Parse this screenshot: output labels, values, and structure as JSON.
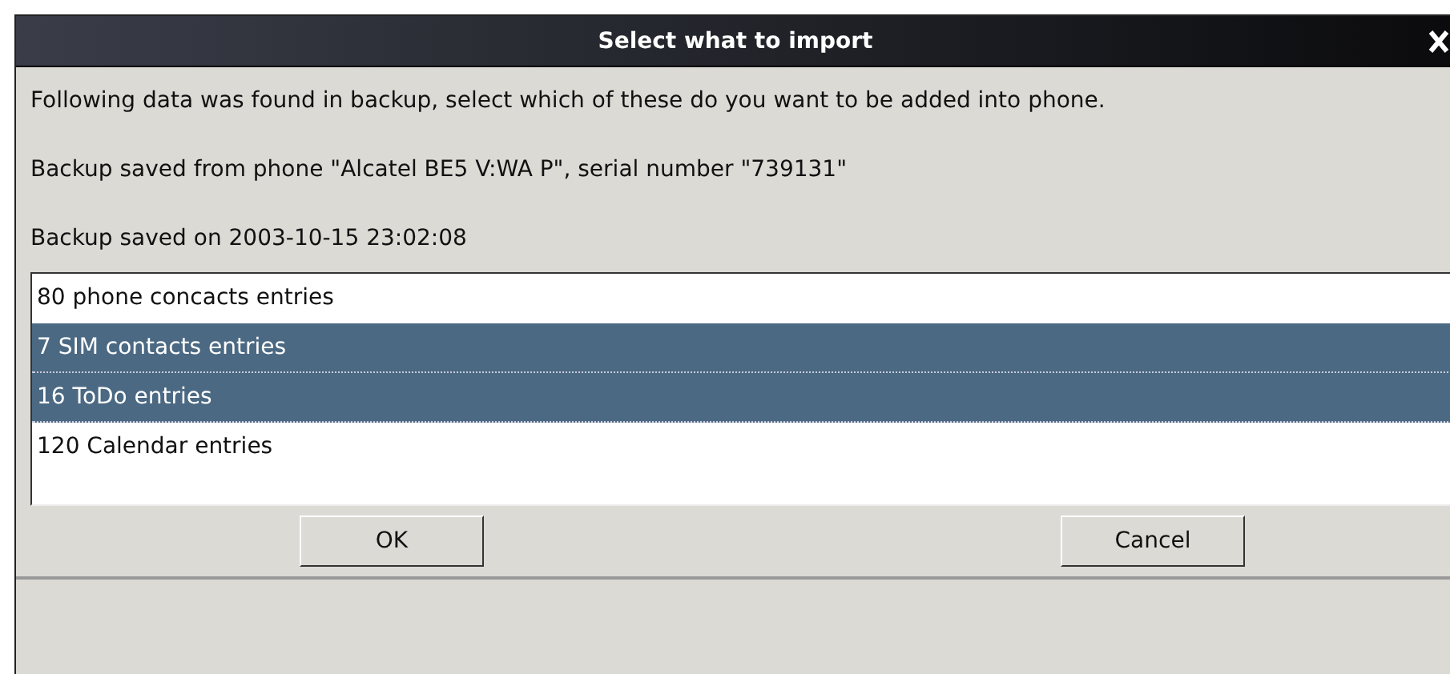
{
  "window": {
    "title": "Select what to import"
  },
  "messages": [
    "Following data was found in backup, select which of these do you want to be added into phone.",
    "Backup saved from phone \"Alcatel BE5 V:WA P\", serial number \"739131\"",
    "Backup saved on 2003-10-15 23:02:08"
  ],
  "list": [
    {
      "label": "80 phone concacts entries",
      "selected": false
    },
    {
      "label": "7 SIM contacts entries",
      "selected": true
    },
    {
      "label": "16 ToDo entries",
      "selected": true
    },
    {
      "label": "120 Calendar entries",
      "selected": false
    }
  ],
  "buttons": [
    "OK",
    "Cancel"
  ]
}
